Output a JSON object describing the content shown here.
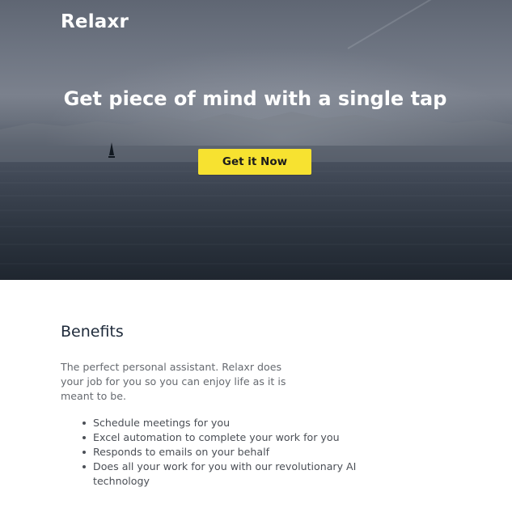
{
  "brand": {
    "name": "Relaxr"
  },
  "hero": {
    "headline": "Get piece of mind with a single tap",
    "cta_label": "Get it Now"
  },
  "benefits": {
    "title": "Benefits",
    "description": "The perfect personal assistant. Relaxr does your job for you so you can enjoy life as it is meant to be.",
    "items": [
      "Schedule meetings for you",
      "Excel automation to complete your work for you",
      "Responds to emails on your behalf",
      "Does all your work for you with our revolutionary AI technology"
    ]
  },
  "colors": {
    "cta_background": "#f7e230",
    "hero_dark": "#1f262f",
    "heading_text": "#1e2a3a",
    "body_text": "#666a70"
  }
}
